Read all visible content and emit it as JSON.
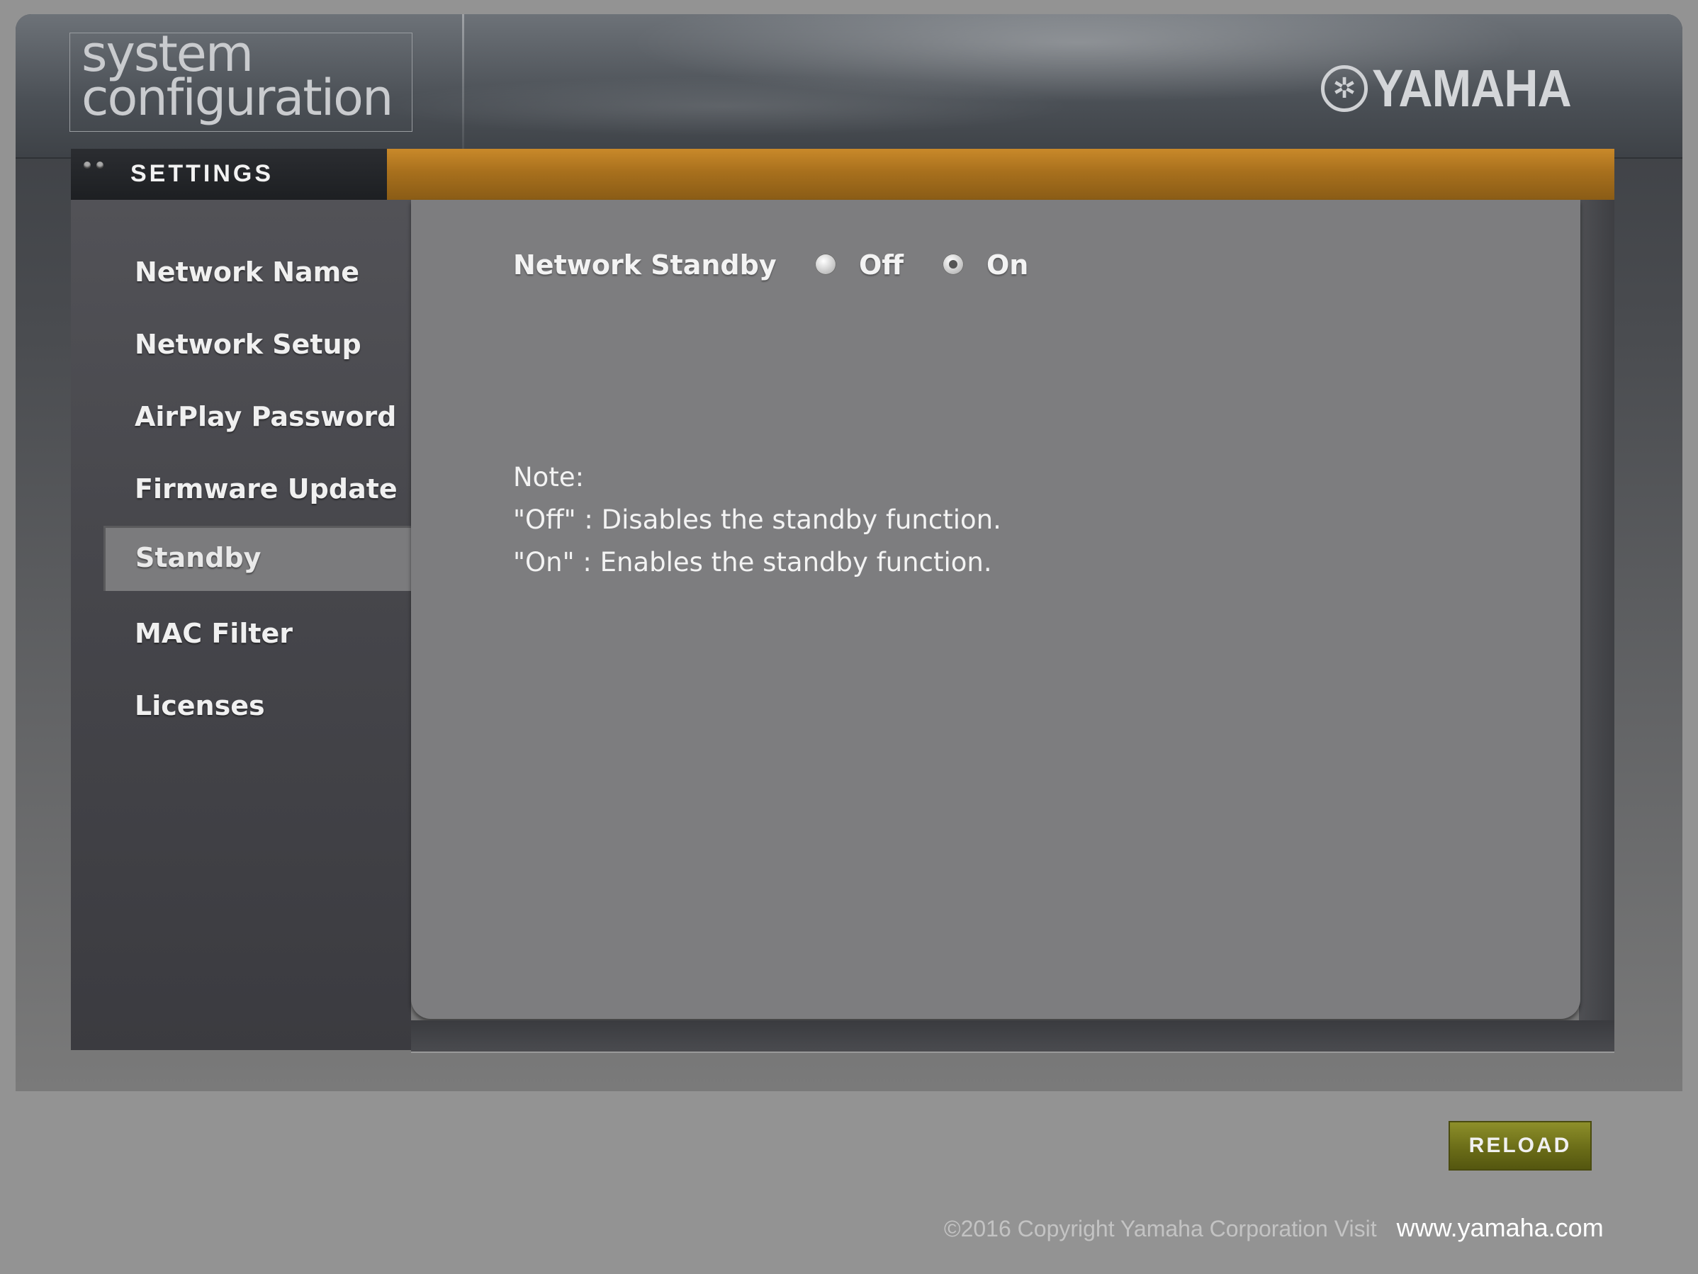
{
  "header": {
    "logo_line1": "system",
    "logo_line2": "configuration",
    "brand": "YAMAHA",
    "brand_icon": "yamaha-tuning-fork-emblem-icon"
  },
  "settings": {
    "title": "SETTINGS"
  },
  "sidebar": {
    "items": [
      {
        "label": "Network Name"
      },
      {
        "label": "Network Setup"
      },
      {
        "label": "AirPlay Password"
      },
      {
        "label": "Firmware Update"
      },
      {
        "label": "Standby",
        "active": true
      },
      {
        "label": "MAC Filter"
      },
      {
        "label": "Licenses"
      }
    ]
  },
  "main": {
    "field_label": "Network Standby",
    "options": [
      {
        "label": "Off",
        "selected": false
      },
      {
        "label": "On",
        "selected": true
      }
    ],
    "note_title": "Note:",
    "note_lines": [
      "\"Off\" : Disables the standby function.",
      "\"On\" : Enables the standby function."
    ]
  },
  "footer": {
    "reload_label": "RELOAD",
    "copyright": "©2016 Copyright Yamaha Corporation Visit",
    "link": "www.yamaha.com"
  },
  "colors": {
    "accent_orange": "#c9892a",
    "reload_olive": "#6b6d18",
    "page_background": "#939393"
  }
}
